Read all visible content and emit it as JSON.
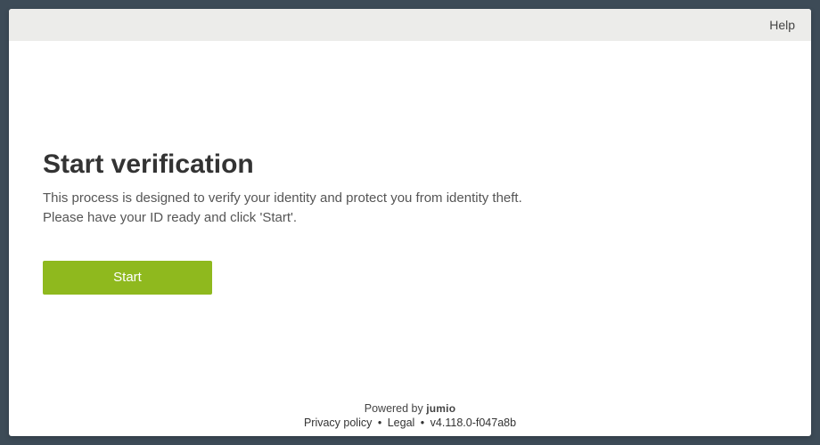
{
  "header": {
    "help_label": "Help"
  },
  "main": {
    "title": "Start verification",
    "description_line1": "This process is designed to verify your identity and protect you from identity theft.",
    "description_line2": "Please have your ID ready and click 'Start'.",
    "start_button_label": "Start"
  },
  "footer": {
    "powered_by_prefix": "Powered by ",
    "brand": "jumio",
    "privacy_label": "Privacy policy",
    "legal_label": "Legal",
    "version": "v4.118.0-f047a8b",
    "separator": "•"
  }
}
